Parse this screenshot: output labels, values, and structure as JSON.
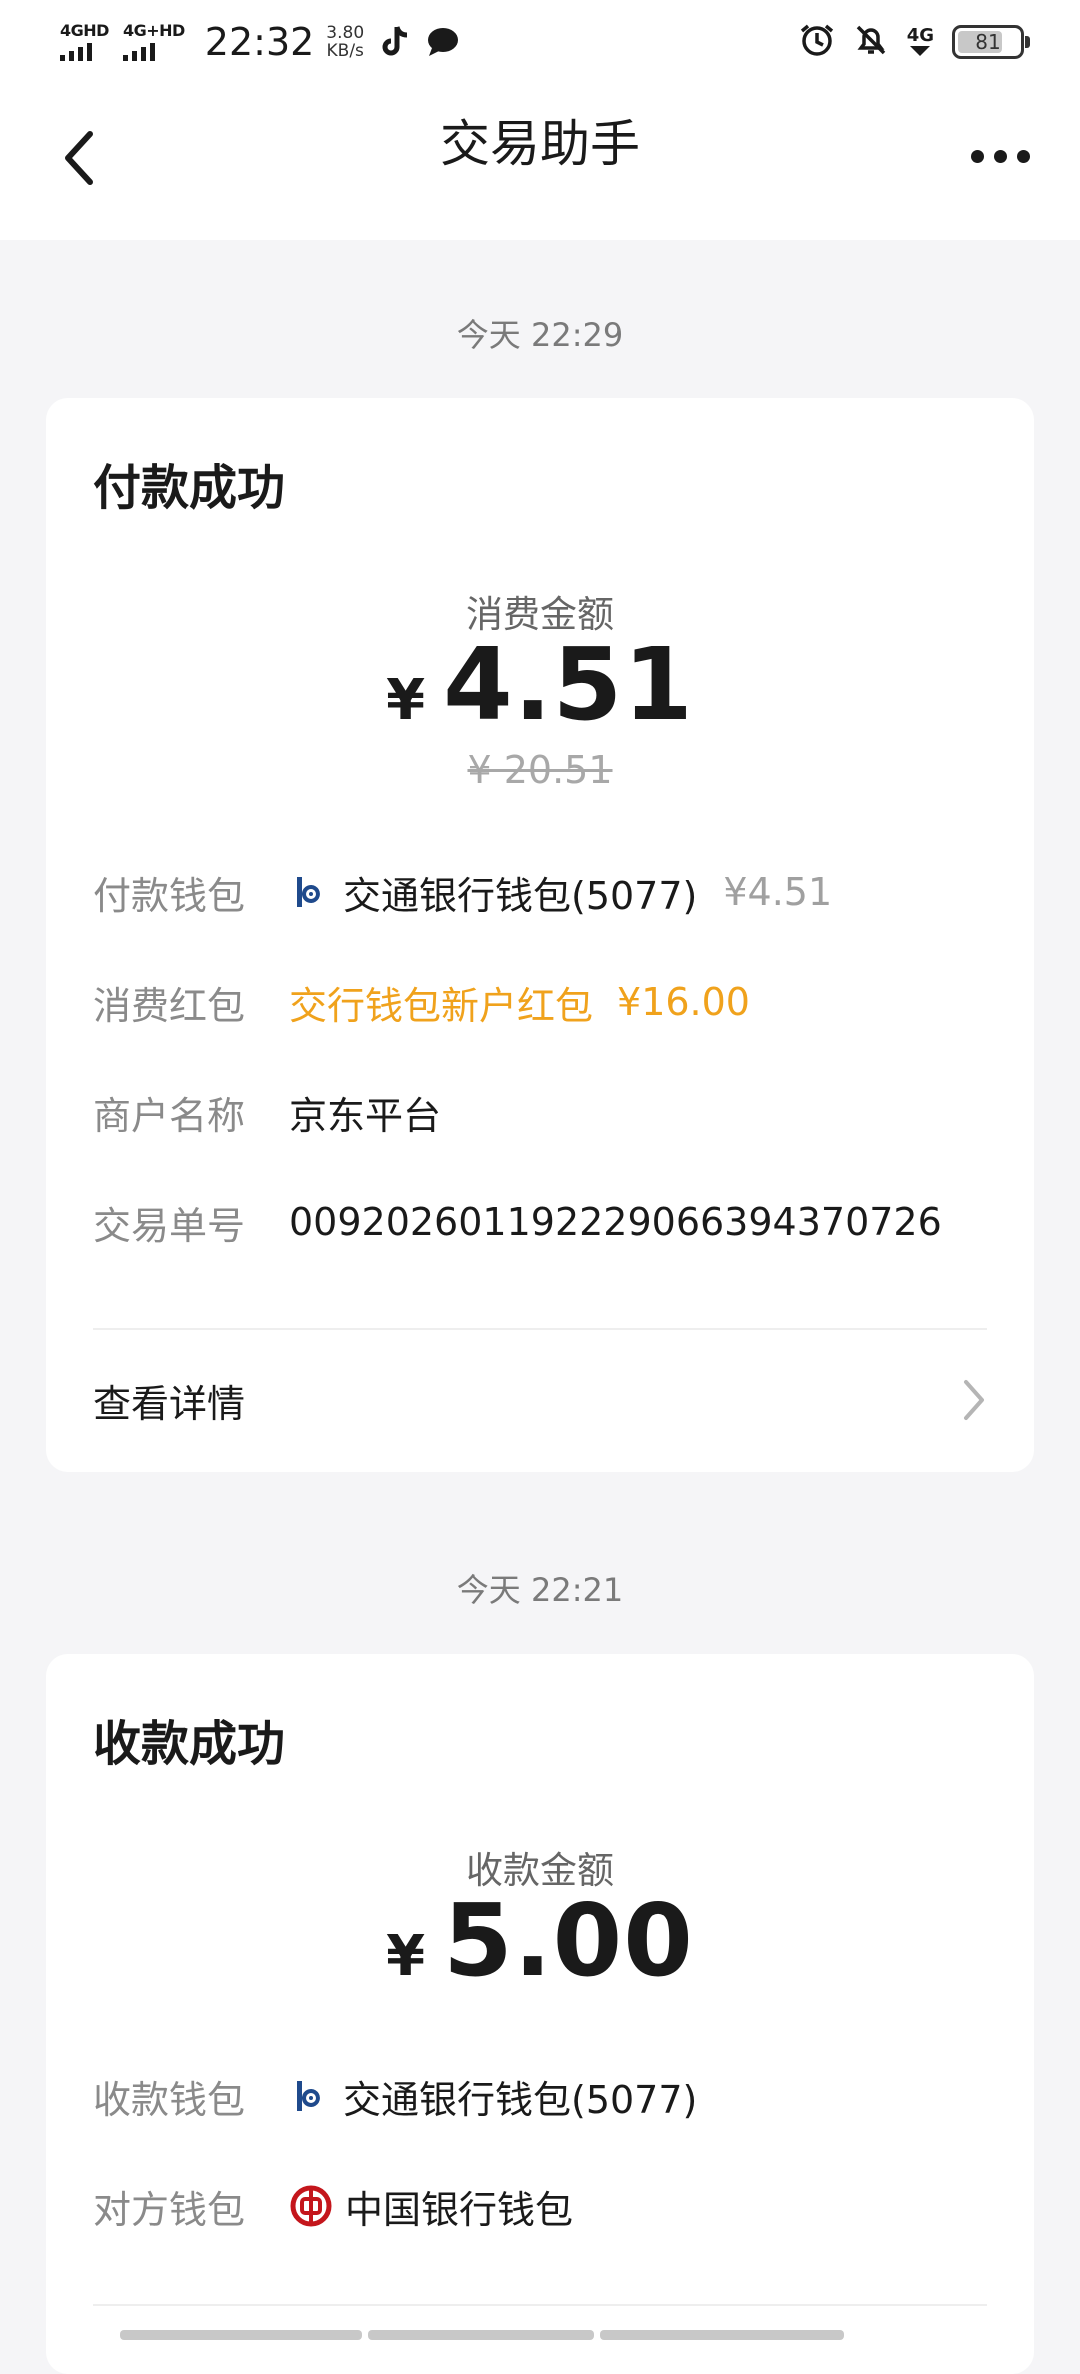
{
  "status_bar": {
    "signal1": "4GHD",
    "signal2": "4G+HD",
    "time": "22:32",
    "speed_value": "3.80",
    "speed_unit": "KB/s",
    "net": "4G",
    "battery": "81",
    "battery_level": 0.81
  },
  "header": {
    "title": "交易助手"
  },
  "payment": {
    "time": "今天 22:29",
    "title": "付款成功",
    "amount_label": "消费金额",
    "currency": "¥",
    "amount": "4.51",
    "original": "¥ 20.51",
    "wallet_key": "付款钱包",
    "wallet_value": "交通银行钱包(5077)",
    "wallet_amount": "¥4.51",
    "coupon_key": "消费红包",
    "coupon_value": "交行钱包新户红包",
    "coupon_amount": "¥16.00",
    "merchant_key": "商户名称",
    "merchant_value": "京东平台",
    "order_key": "交易单号",
    "order_value": "00920260119222906639437072​6",
    "detail_label": "查看详情"
  },
  "receipt": {
    "time": "今天 22:21",
    "title": "收款成功",
    "amount_label": "收款金额",
    "currency": "¥",
    "amount": "5.00",
    "wallet_key": "收款钱包",
    "wallet_value": "交通银行钱包(5077)",
    "other_key": "对方钱包",
    "other_value": "中国银行钱包"
  },
  "colors": {
    "background": "#f5f5f7",
    "card": "#ffffff",
    "coupon": "#f0a21c",
    "bocom_blue": "#1f4a8c",
    "boc_red": "#c4161c"
  }
}
